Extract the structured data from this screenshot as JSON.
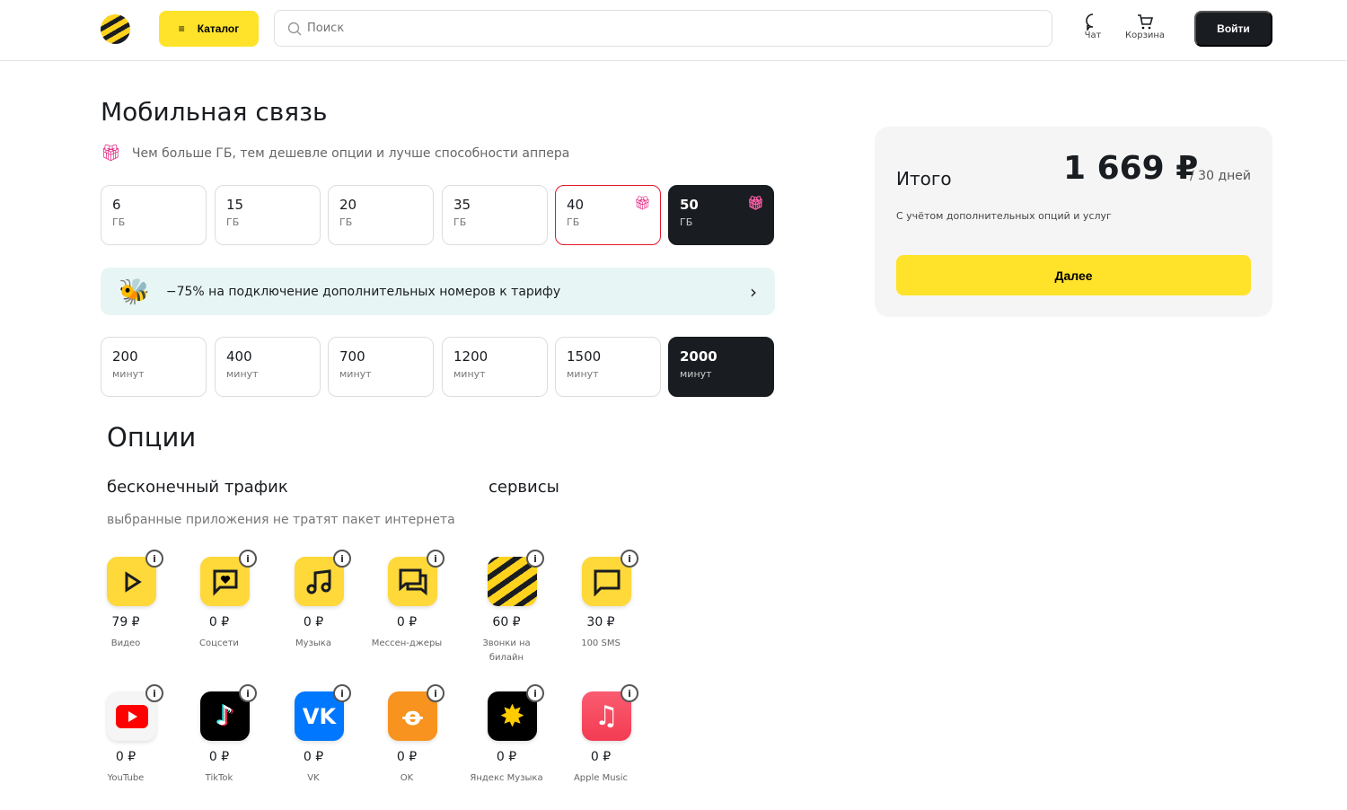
{
  "header": {
    "catalog": "Каталог",
    "search_placeholder": "Поиск",
    "chat": "Чат",
    "cart": "Корзина",
    "login": "Войти"
  },
  "title": "Мобильная связь",
  "promo_text": "Чем больше ГБ, тем дешевле опции и лучше способности аппера",
  "gb": [
    {
      "v": "6",
      "u": "ГБ"
    },
    {
      "v": "15",
      "u": "ГБ"
    },
    {
      "v": "20",
      "u": "ГБ"
    },
    {
      "v": "35",
      "u": "ГБ"
    },
    {
      "v": "40",
      "u": "ГБ",
      "gift": true
    },
    {
      "v": "50",
      "u": "ГБ",
      "gift": true,
      "selected": true
    }
  ],
  "banner": "−75% на подключение дополнительных номеров к тарифу",
  "minutes": [
    {
      "v": "200",
      "u": "минут"
    },
    {
      "v": "400",
      "u": "минут"
    },
    {
      "v": "700",
      "u": "минут"
    },
    {
      "v": "1200",
      "u": "минут"
    },
    {
      "v": "1500",
      "u": "минут"
    },
    {
      "v": "2000",
      "u": "минут",
      "selected": true
    }
  ],
  "options": {
    "title": "Опции",
    "traffic_title": "бесконечный трафик",
    "services_title": "сервисы",
    "traffic_desc": "выбранные приложения не тратят пакет интернета",
    "row1": [
      {
        "icon": "play-icon",
        "price": "79 ₽",
        "label": "Видео"
      },
      {
        "icon": "social-chat-icon",
        "price": "0 ₽",
        "label": "Соцсети"
      },
      {
        "icon": "music-note-icon",
        "price": "0 ₽",
        "label": "Музыка"
      },
      {
        "icon": "messenger-icon",
        "price": "0 ₽",
        "label": "Мессен-джеры"
      },
      {
        "icon": "beeline-logo-icon",
        "price": "60 ₽",
        "label": "Звонки на билайн"
      },
      {
        "icon": "sms-icon",
        "price": "30 ₽",
        "label": "100 SMS"
      }
    ],
    "row2": [
      {
        "icon": "youtube-icon",
        "price": "0 ₽",
        "label": "YouTube"
      },
      {
        "icon": "tiktok-icon",
        "price": "0 ₽",
        "label": "TikTok"
      },
      {
        "icon": "vk-icon",
        "price": "0 ₽",
        "label": "VK"
      },
      {
        "icon": "ok-icon",
        "price": "0 ₽",
        "label": "OK"
      },
      {
        "icon": "yandex-music-icon",
        "price": "0 ₽",
        "label": "Яндекс Музыка"
      },
      {
        "icon": "apple-music-icon",
        "price": "0 ₽",
        "label": "Apple Music"
      }
    ]
  },
  "summary": {
    "label": "Итого",
    "price": "1 669 ₽",
    "period": "/ 30 дней",
    "note": "С учётом дополнительных опций и услуг",
    "next": "Далее"
  },
  "colors": {
    "accent": "#ffe32a",
    "dark": "#191c20",
    "gift": "#e0187a"
  }
}
